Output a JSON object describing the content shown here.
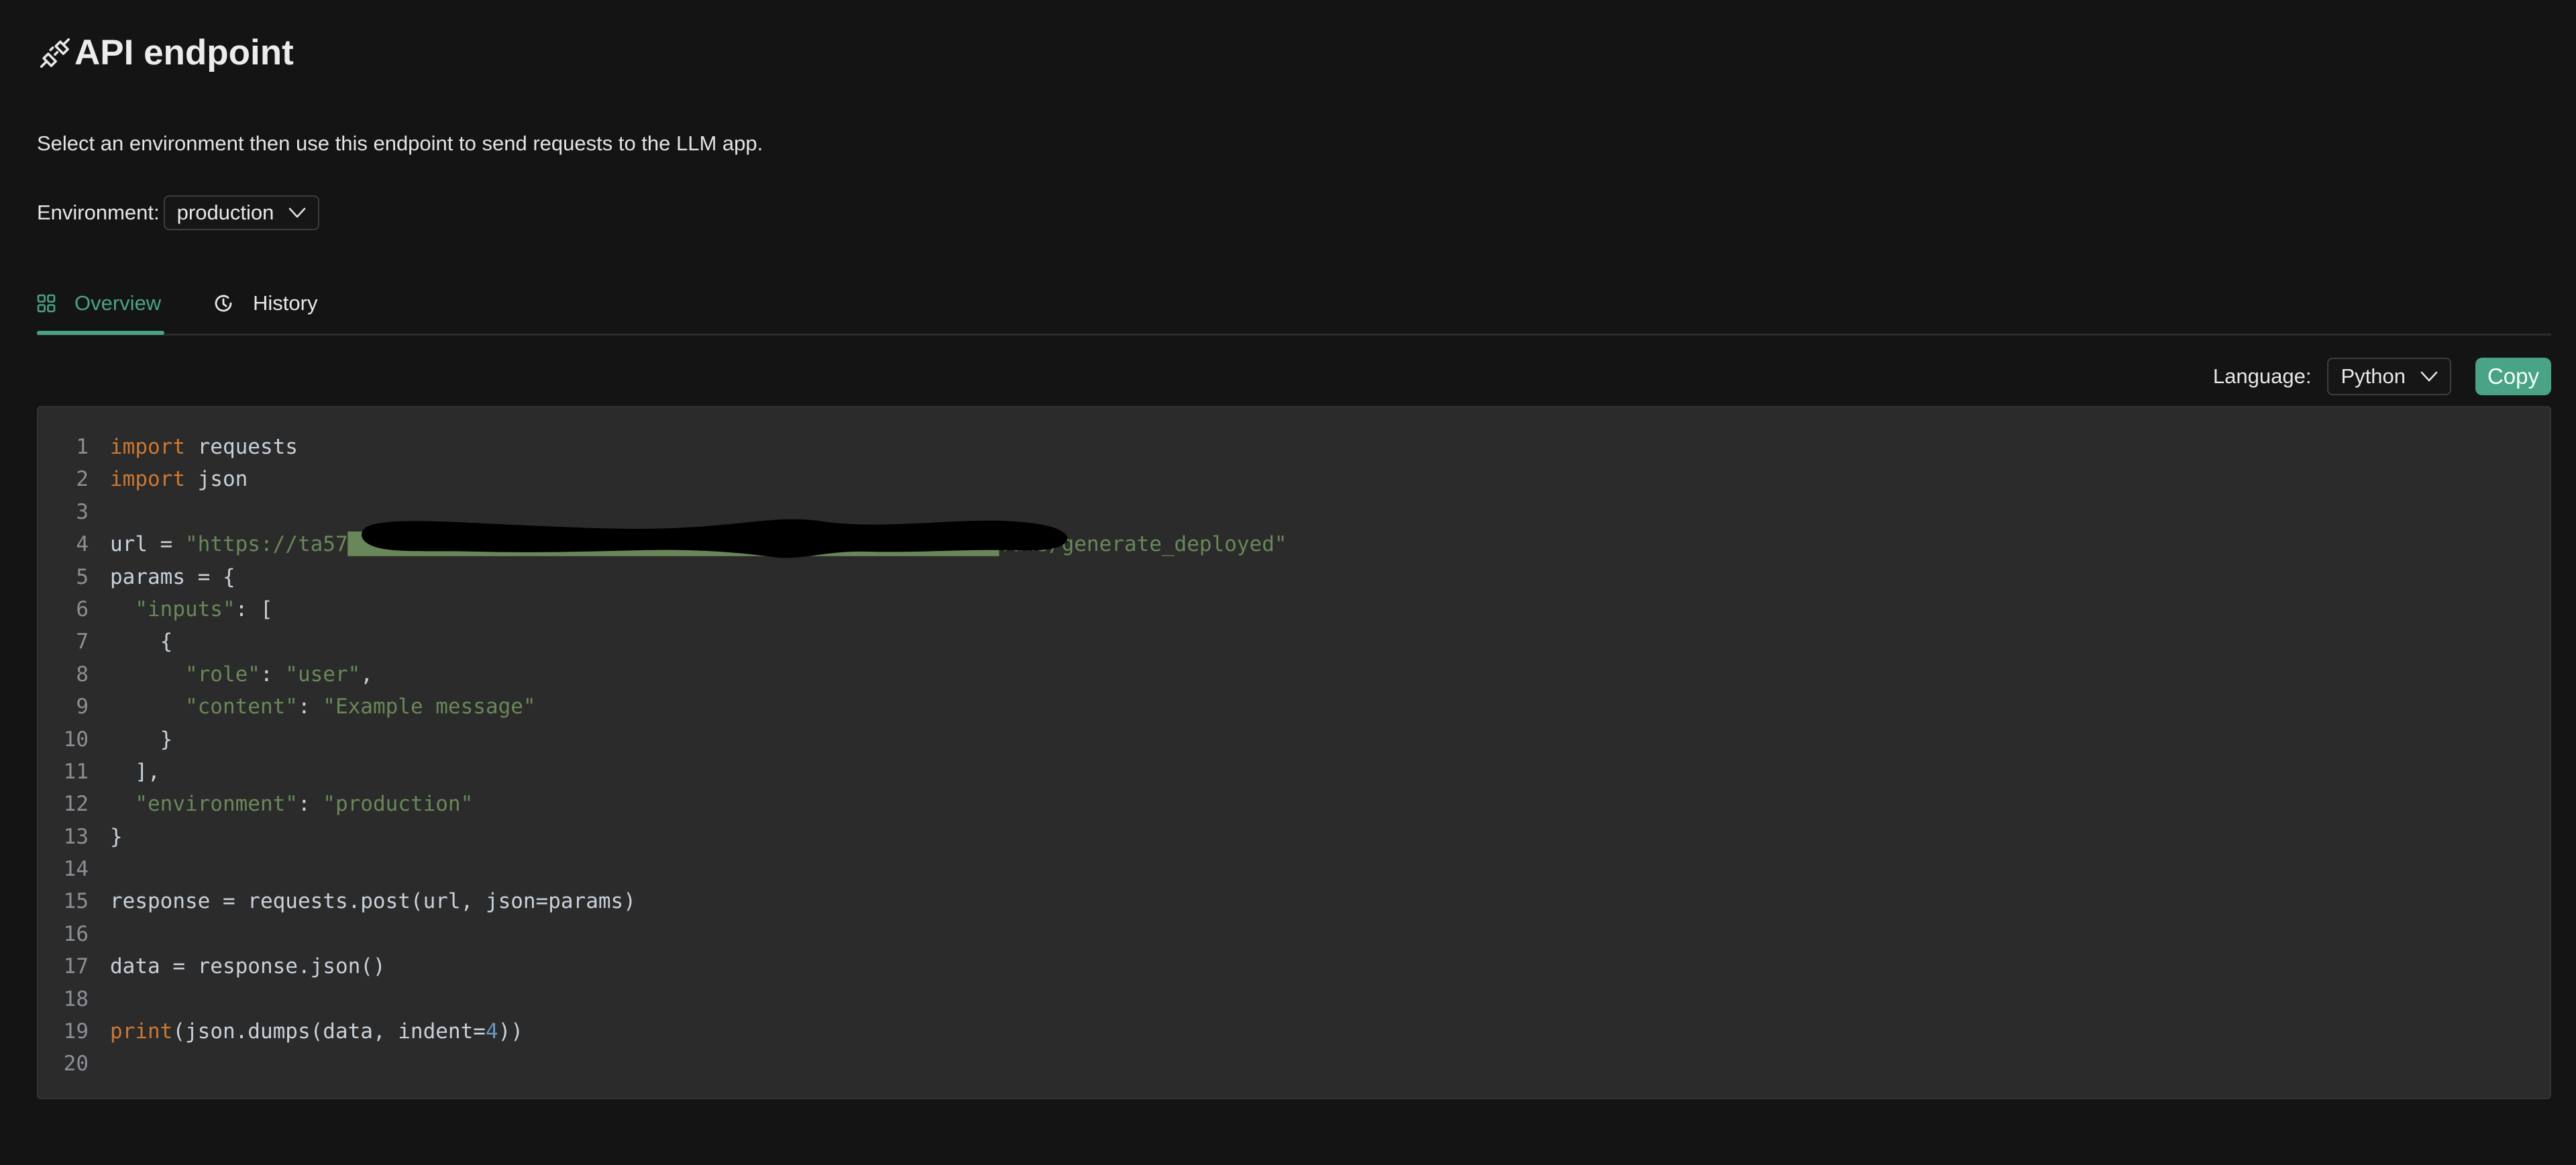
{
  "header": {
    "title": "API endpoint",
    "icon": "plug-icon",
    "subtitle": "Select an environment then use this endpoint to send requests to the LLM app."
  },
  "environment": {
    "label": "Environment:",
    "selected": "production"
  },
  "tabs": [
    {
      "label": "Overview",
      "icon": "grid-icon",
      "active": true
    },
    {
      "label": "History",
      "icon": "history-icon",
      "active": false
    }
  ],
  "code_toolbar": {
    "language_label": "Language:",
    "language_selected": "Python",
    "copy_label": "Copy"
  },
  "colors": {
    "accent": "#4aa386",
    "background": "#141414",
    "code_background": "#2b2b2b",
    "keyword": "#cc7832",
    "string": "#6a8759",
    "number": "#6897bb"
  },
  "code": {
    "language": "python",
    "url_redacted": true,
    "lines": [
      [
        {
          "t": "import",
          "c": "kw"
        },
        {
          "t": " requests"
        }
      ],
      [
        {
          "t": "import",
          "c": "kw"
        },
        {
          "t": " json"
        }
      ],
      [],
      [
        {
          "t": "url = "
        },
        {
          "t": "\"https://ta57",
          "c": "str"
        },
        {
          "t": "████████████████████████████████████████████████████",
          "c": "str"
        },
        {
          "t": ".aws/generate_deployed\"",
          "c": "str"
        }
      ],
      [
        {
          "t": "params = {"
        }
      ],
      [
        {
          "t": "  "
        },
        {
          "t": "\"inputs\"",
          "c": "str"
        },
        {
          "t": ": ["
        }
      ],
      [
        {
          "t": "    {"
        }
      ],
      [
        {
          "t": "      "
        },
        {
          "t": "\"role\"",
          "c": "str"
        },
        {
          "t": ": "
        },
        {
          "t": "\"user\"",
          "c": "str"
        },
        {
          "t": ","
        }
      ],
      [
        {
          "t": "      "
        },
        {
          "t": "\"content\"",
          "c": "str"
        },
        {
          "t": ": "
        },
        {
          "t": "\"Example message\"",
          "c": "str"
        }
      ],
      [
        {
          "t": "    }"
        }
      ],
      [
        {
          "t": "  ],"
        }
      ],
      [
        {
          "t": "  "
        },
        {
          "t": "\"environment\"",
          "c": "str"
        },
        {
          "t": ": "
        },
        {
          "t": "\"production\"",
          "c": "str"
        }
      ],
      [
        {
          "t": "}"
        }
      ],
      [],
      [
        {
          "t": "response = requests.post(url, json=params)"
        }
      ],
      [],
      [
        {
          "t": "data = response.json()"
        }
      ],
      [],
      [
        {
          "t": "print",
          "c": "kw"
        },
        {
          "t": "(json.dumps(data, indent="
        },
        {
          "t": "4",
          "c": "num"
        },
        {
          "t": "))"
        }
      ],
      []
    ]
  }
}
